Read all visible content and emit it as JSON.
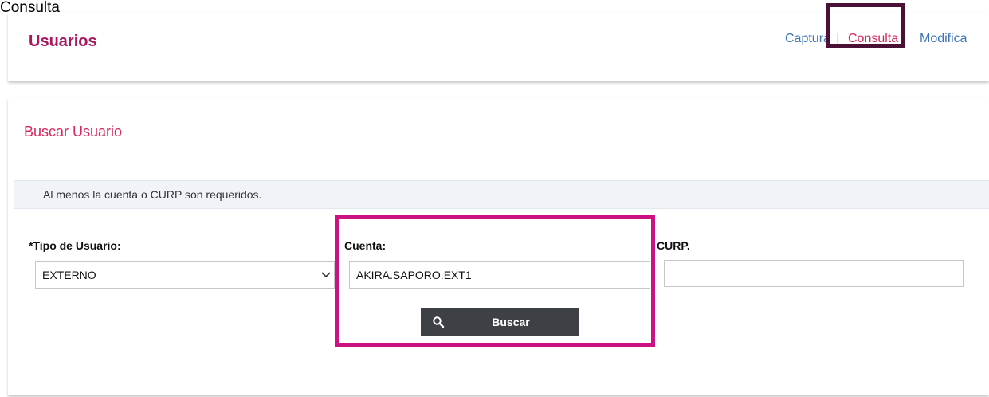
{
  "top_text": "Consulta",
  "header": {
    "title": "Usuarios",
    "nav": {
      "captura": "Captura",
      "separator": "|",
      "consulta": "Consulta",
      "modifica": "Modifica"
    }
  },
  "search": {
    "section_title": "Buscar Usuario",
    "info_message": "Al menos la cuenta o CURP son requeridos.",
    "tipo_label": "*Tipo de Usuario:",
    "tipo_value": "EXTERNO",
    "cuenta_label": "Cuenta:",
    "cuenta_value": "AKIRA.SAPORO.EXT1",
    "curp_label": "CURP.",
    "curp_value": "",
    "button_label": "Buscar"
  },
  "icons": {
    "dropdown": "chevron-down-icon",
    "search": "search-icon"
  },
  "colors": {
    "title": "#a8185f",
    "accent": "#d62860",
    "link": "#3a73b7",
    "button_bg": "#3d4145",
    "highlight_nav": "#4a1036",
    "highlight_form": "#cc1282",
    "info_bar": "#f0f3f8"
  }
}
